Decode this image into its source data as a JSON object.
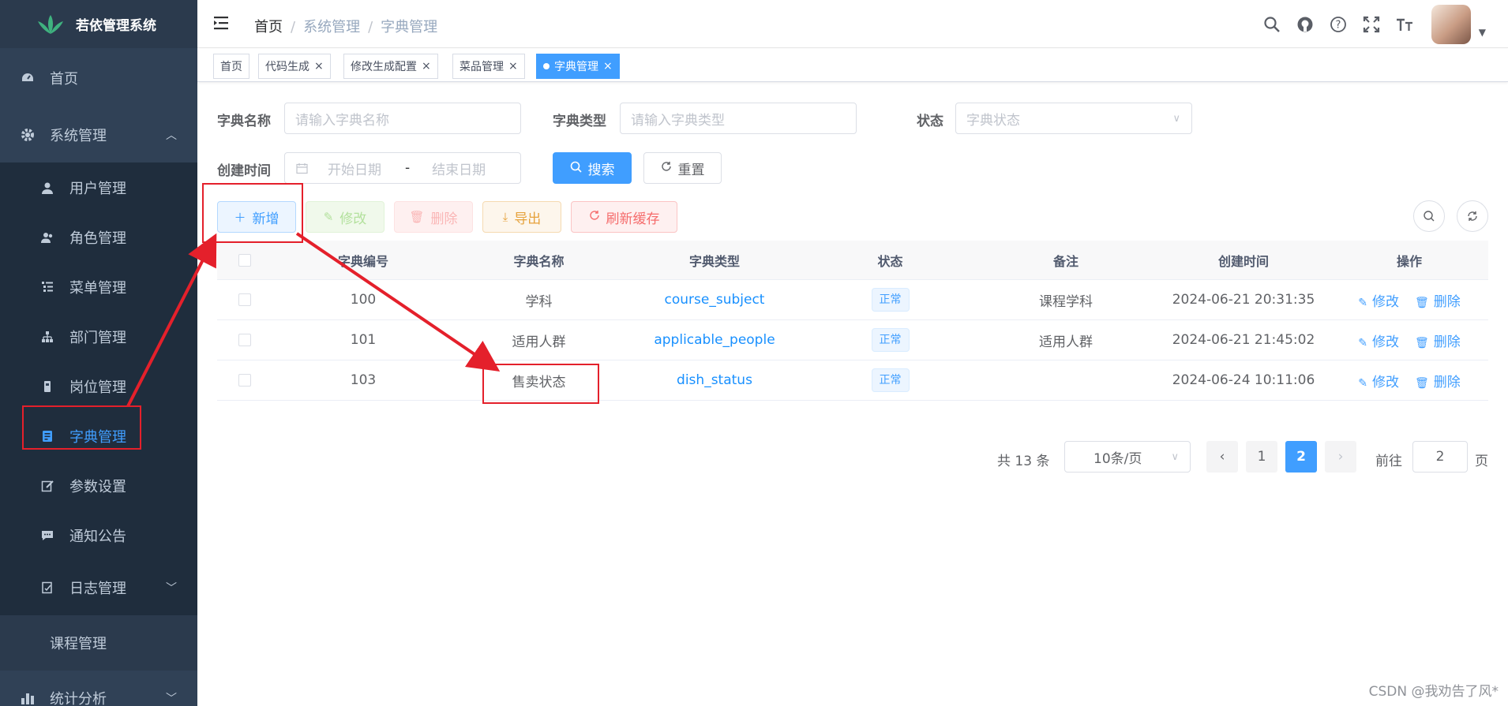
{
  "app": {
    "title": "若依管理系统"
  },
  "sidebar": {
    "home": "首页",
    "system": "系统管理",
    "sub": [
      {
        "label": "用户管理",
        "icon": "user-icon"
      },
      {
        "label": "角色管理",
        "icon": "peoples-icon"
      },
      {
        "label": "菜单管理",
        "icon": "tree-table-icon"
      },
      {
        "label": "部门管理",
        "icon": "tree-icon"
      },
      {
        "label": "岗位管理",
        "icon": "post-icon"
      },
      {
        "label": "字典管理",
        "icon": "dict-icon"
      },
      {
        "label": "参数设置",
        "icon": "edit-icon"
      },
      {
        "label": "通知公告",
        "icon": "message-icon"
      },
      {
        "label": "日志管理",
        "icon": "log-icon"
      }
    ],
    "course": "课程管理",
    "stats": "统计分析"
  },
  "breadcrumb": [
    "首页",
    "系统管理",
    "字典管理"
  ],
  "tags": [
    {
      "label": "首页"
    },
    {
      "label": "代码生成"
    },
    {
      "label": "修改生成配置"
    },
    {
      "label": "菜品管理"
    },
    {
      "label": "字典管理"
    }
  ],
  "form": {
    "dict_name_label": "字典名称",
    "dict_name_placeholder": "请输入字典名称",
    "dict_type_label": "字典类型",
    "dict_type_placeholder": "请输入字典类型",
    "status_label": "状态",
    "status_placeholder": "字典状态",
    "create_time_label": "创建时间",
    "start_placeholder": "开始日期",
    "range_sep": "-",
    "end_placeholder": "结束日期",
    "search": "搜索",
    "reset": "重置"
  },
  "toolbar": {
    "add": "新增",
    "edit": "修改",
    "delete": "删除",
    "export": "导出",
    "refresh_cache": "刷新缓存"
  },
  "table": {
    "headers": [
      "字典编号",
      "字典名称",
      "字典类型",
      "状态",
      "备注",
      "创建时间",
      "操作"
    ],
    "rows": [
      {
        "id": "100",
        "name": "学科",
        "type": "course_subject",
        "status": "正常",
        "remark": "课程学科",
        "created": "2024-06-21 20:31:35"
      },
      {
        "id": "101",
        "name": "适用人群",
        "type": "applicable_people",
        "status": "正常",
        "remark": "适用人群",
        "created": "2024-06-21 21:45:02"
      },
      {
        "id": "103",
        "name": "售卖状态",
        "type": "dish_status",
        "status": "正常",
        "remark": "",
        "created": "2024-06-24 10:11:06"
      }
    ],
    "op_edit": "修改",
    "op_delete": "删除"
  },
  "pagination": {
    "total": "共 13 条",
    "page_size": "10条/页",
    "pages": [
      "1",
      "2"
    ],
    "current": "2",
    "goto_label": "前往",
    "goto_value": "2",
    "page_unit": "页"
  },
  "watermark": "CSDN @我劝告了风*",
  "colors": {
    "primary": "#409eff",
    "sidebar_bg": "#304156",
    "annotation_red": "#e4202b"
  }
}
